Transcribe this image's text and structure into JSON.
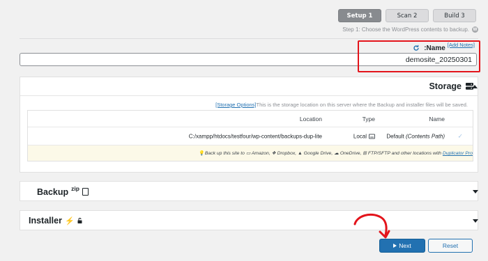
{
  "steps": [
    {
      "label": "Setup 1",
      "active": true
    },
    {
      "label": "Scan 2",
      "active": false
    },
    {
      "label": "Build 3",
      "active": false
    }
  ],
  "step_caption": "Step 1: Choose the WordPress contents to backup.",
  "name_section": {
    "label": ":Name",
    "add_notes": "[Add Notes]",
    "value": "demosite_20250301"
  },
  "storage": {
    "title": "Storage",
    "description": "This is the storage location on this server where the Backup and installer files will be saved.",
    "options_link": "[Storage Options]",
    "columns": {
      "location": "Location",
      "type": "Type",
      "name": "Name"
    },
    "row": {
      "location": "C:/xampp/htdocs/testfour/wp-content/backups-dup-lite",
      "type": "Local",
      "name_prefix": "Default ",
      "name_suffix": "(Contents Path)"
    },
    "info": {
      "text": "Back up this site to ",
      "amazon": "Amazon, ",
      "dropbox": "Dropbox, ",
      "gdrive": "Google Drive, ",
      "onedrive": "OneDrive, ",
      "ftp": "FTP/SFTP and other locations with ",
      "link": "Duplicator Pro"
    }
  },
  "backup": {
    "title": "Backup",
    "sup": "zip"
  },
  "installer": {
    "title": "Installer"
  },
  "buttons": {
    "next": "Next",
    "reset": "Reset"
  },
  "colors": {
    "accent": "#2271b1",
    "highlight": "#e3141b",
    "info_bg": "#fcf9e8"
  }
}
